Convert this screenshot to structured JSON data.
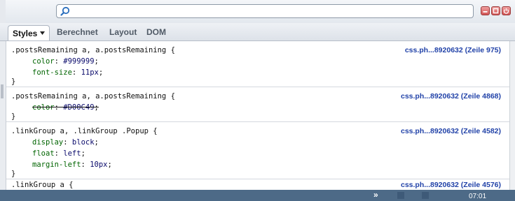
{
  "toolbar": {
    "search_value": "",
    "search_placeholder": ""
  },
  "tabs": [
    {
      "label": "Styles",
      "active": true
    },
    {
      "label": "Berechnet"
    },
    {
      "label": "Layout"
    },
    {
      "label": "DOM"
    }
  ],
  "rules": [
    {
      "selector": ".postsRemaining a, a.postsRemaining {",
      "source": "css.ph...8920632 (Zeile 975)",
      "properties": [
        {
          "name": "color",
          "value": "#999999",
          "overridden": false
        },
        {
          "name": "font-size",
          "value": "11px",
          "overridden": false
        }
      ],
      "close": "}"
    },
    {
      "selector": ".postsRemaining a, a.postsRemaining {",
      "source": "css.ph...8920632 (Zeile 4868)",
      "properties": [
        {
          "name": "color",
          "value": "#D00C49",
          "overridden": true
        }
      ],
      "close": "}"
    },
    {
      "selector": ".linkGroup a, .linkGroup .Popup {",
      "source": "css.ph...8920632 (Zeile 4582)",
      "properties": [
        {
          "name": "display",
          "value": "block",
          "overridden": false
        },
        {
          "name": "float",
          "value": "left",
          "overridden": false
        },
        {
          "name": "margin-left",
          "value": "10px",
          "overridden": false
        }
      ],
      "close": "}"
    },
    {
      "selector": ".linkGroup a {",
      "source": "css.ph...8920632 (Zeile 4576)",
      "properties": [],
      "close": ""
    }
  ],
  "taskbar": {
    "chevron": "»",
    "clock": "07:01"
  },
  "colors": {
    "property_name": "#006400",
    "property_value": "#0a0a6b",
    "source_link": "#2142a8",
    "taskbar": "#4d6a87"
  },
  "icons": {
    "search": "search-icon",
    "minimize": "minimize-icon",
    "restore": "restore-icon",
    "power": "power-icon",
    "tab_dropdown": "chevron-down-icon"
  }
}
